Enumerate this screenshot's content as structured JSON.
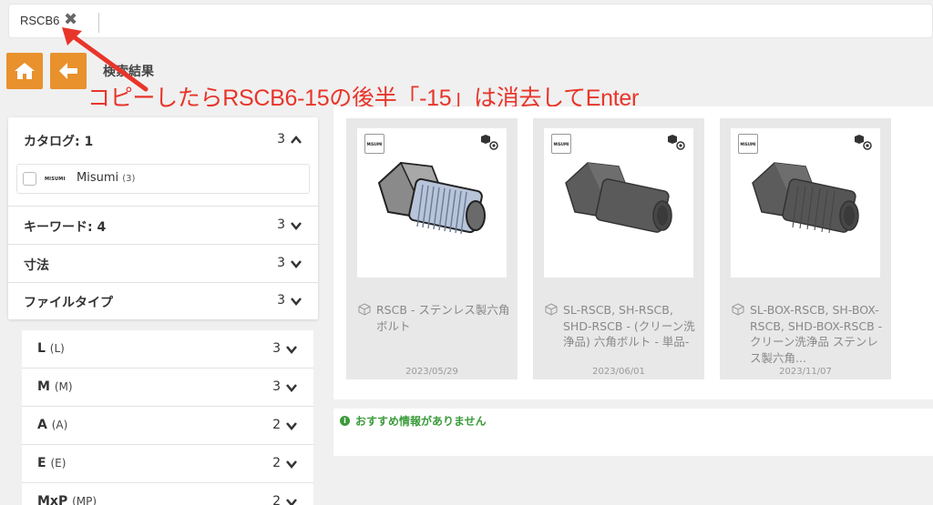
{
  "search": {
    "tag": "RSCB6",
    "close_icon": "close-icon"
  },
  "toolbar": {
    "home_icon": "home-icon",
    "back_icon": "arrow-left-icon",
    "title": "検索結果"
  },
  "annotation": {
    "text": "コピーしたらRSCB6-15の後半「-15」は消去してEnter",
    "color": "#e8352a"
  },
  "sidebar": {
    "catalog": {
      "label": "カタログ: 1",
      "count": "3"
    },
    "maker": {
      "logo": "MISUMI",
      "name": "Misumi",
      "count": "(3)"
    },
    "keyword": {
      "label": "キーワード: 4",
      "count": "3"
    },
    "dimension": {
      "label": "寸法",
      "count": "3"
    },
    "filetype": {
      "label": "ファイルタイプ",
      "count": "3"
    },
    "sub_facets": [
      {
        "label": "L",
        "paren": "(L)",
        "count": "3"
      },
      {
        "label": "M",
        "paren": "(M)",
        "count": "3"
      },
      {
        "label": "A",
        "paren": "(A)",
        "count": "2"
      },
      {
        "label": "E",
        "paren": "(E)",
        "count": "2"
      },
      {
        "label": "MxP",
        "paren": "(MP)",
        "count": "2"
      }
    ]
  },
  "results": [
    {
      "logo": "MISUMI",
      "title": "RSCB - ステンレス製六角ボルト",
      "date": "2023/05/29",
      "style": "stainless"
    },
    {
      "logo": "MISUMI",
      "title": "SL-RSCB, SH-RSCB, SHD-RSCB - (クリーン洗浄品) 六角ボルト - 単品-",
      "date": "2023/06/01",
      "style": "gray"
    },
    {
      "logo": "MISUMI",
      "title": "SL-BOX-RSCB, SH-BOX-RSCB, SHD-BOX-RSCB - クリーン洗浄品 ステンレス製六角...",
      "date": "2023/11/07",
      "style": "gray"
    }
  ],
  "recommend": {
    "icon": "info-icon",
    "text": "おすすめ情報がありません",
    "color": "#3b9b3b"
  },
  "colors": {
    "accent": "#e8912d",
    "annotation": "#e8352a"
  }
}
